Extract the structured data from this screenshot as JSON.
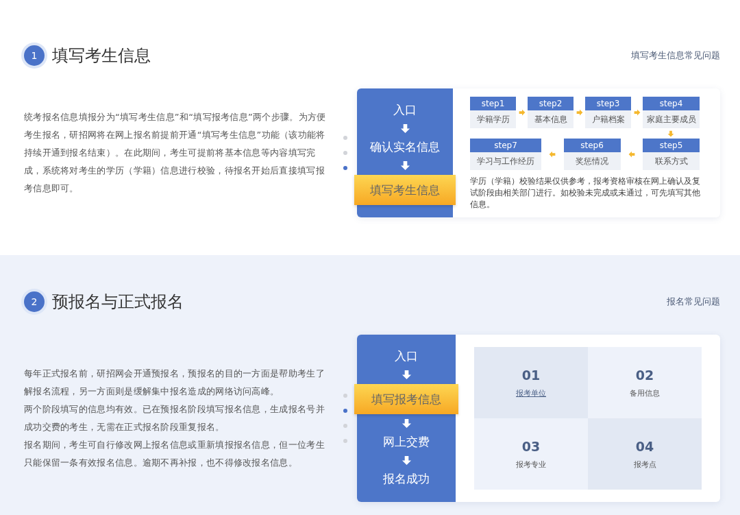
{
  "sections": [
    {
      "number": "1",
      "title": "填写考生信息",
      "faq_link": "填写考生信息常见问题",
      "paragraphs": [
        "统考报名信息填报分为“填写考生信息”和“填写报考信息”两个步骤。为方便考生报名，研招网将在网上报名前提前开通“填写考生信息”功能（该功能将持续开通到报名结束）。在此期间，考生可提前将基本信息等内容填写完成，系统将对考生的学历（学籍）信息进行校验，待报名开始后直接填写报考信息即可。"
      ],
      "nav_dots": [
        {
          "selected": false
        },
        {
          "selected": false
        },
        {
          "selected": true
        }
      ],
      "flow": [
        {
          "label": "入口",
          "highlighted": false
        },
        {
          "label": "确认实名信息",
          "highlighted": false
        },
        {
          "label": "填写考生信息",
          "highlighted": true
        }
      ],
      "panel": {
        "kind": "steps",
        "steps": [
          {
            "step": "step1",
            "label": "学籍学历"
          },
          {
            "step": "step2",
            "label": "基本信息"
          },
          {
            "step": "step3",
            "label": "户籍档案"
          },
          {
            "step": "step4",
            "label": "家庭主要成员"
          },
          {
            "step": "step7",
            "label": "学习与工作经历"
          },
          {
            "step": "step6",
            "label": "奖惩情况"
          },
          {
            "step": "step5",
            "label": "联系方式"
          }
        ],
        "note": "学历（学籍）校验结果仅供参考，报考资格审核在网上确认及复试阶段由相关部门进行。如校验未完成或未通过，可先填写其他信息。"
      }
    },
    {
      "number": "2",
      "title": "预报名与正式报名",
      "faq_link": "报名常见问题",
      "paragraphs": [
        "每年正式报名前，研招网会开通预报名，预报名的目的一方面是帮助考生了解报名流程，另一方面则是缓解集中报名造成的网络访问高峰。",
        "两个阶段填写的信息均有效。已在预报名阶段填写报名信息，生成报名号并成功交费的考生，无需在正式报名阶段重复报名。",
        "报名期间，考生可自行修改网上报名信息或重新填报报名信息，但一位考生只能保留一条有效报名信息。逾期不再补报，也不得修改报名信息。"
      ],
      "nav_dots": [
        {
          "selected": false
        },
        {
          "selected": true
        },
        {
          "selected": false
        },
        {
          "selected": false
        }
      ],
      "flow": [
        {
          "label": "入口",
          "highlighted": false
        },
        {
          "label": "填写报考信息",
          "highlighted": true
        },
        {
          "label": "网上交费",
          "highlighted": false
        },
        {
          "label": "报名成功",
          "highlighted": false
        }
      ],
      "panel": {
        "kind": "grid",
        "cells": [
          {
            "number": "01",
            "label": "报考单位",
            "link": true
          },
          {
            "number": "02",
            "label": "备用信息",
            "link": false
          },
          {
            "number": "03",
            "label": "报考专业",
            "link": false
          },
          {
            "number": "04",
            "label": "报考点",
            "link": false
          }
        ]
      }
    }
  ]
}
